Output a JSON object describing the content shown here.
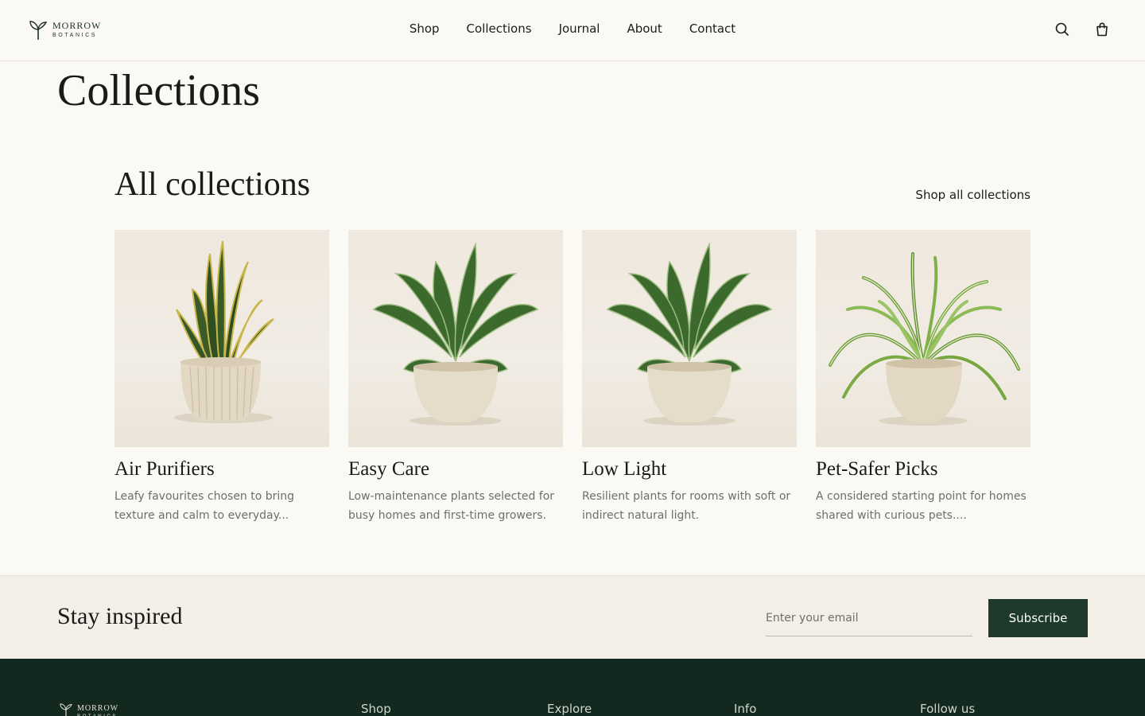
{
  "brand": {
    "name": "MORROW",
    "sub": "BOTANICS",
    "colors": {
      "primary": "#1d3a2c",
      "footer": "#13291f",
      "background": "#faf9f4",
      "newsletter_bg": "#f3efe6"
    }
  },
  "nav": {
    "items": [
      "Shop",
      "Collections",
      "Journal",
      "About",
      "Contact"
    ],
    "search_icon": "search-icon",
    "cart_icon": "shopping-bag-icon"
  },
  "page": {
    "title": "Collections"
  },
  "section": {
    "title": "All collections",
    "link": "Shop all collections"
  },
  "collections": [
    {
      "title": "Air Purifiers",
      "desc_line1": "Leafy favourites chosen to bring",
      "desc_line2": "texture and calm to everyday...",
      "image": "snake-plant"
    },
    {
      "title": "Easy Care",
      "desc_line1": "Low-maintenance plants selected for",
      "desc_line2": "busy homes and first-time growers.",
      "image": "aglaonema-plant"
    },
    {
      "title": "Low Light",
      "desc_line1": "Resilient plants for rooms with soft or",
      "desc_line2": "indirect natural light.",
      "image": "aglaonema-plant"
    },
    {
      "title": "Pet-Safer Picks",
      "desc_line1": "A considered starting point for homes",
      "desc_line2": "shared with curious pets....",
      "image": "spider-plant"
    }
  ],
  "newsletter": {
    "title": "Stay inspired",
    "placeholder": "Enter your email",
    "button": "Subscribe"
  },
  "footer": {
    "columns": [
      "Shop",
      "Explore",
      "Info",
      "Follow us"
    ]
  }
}
